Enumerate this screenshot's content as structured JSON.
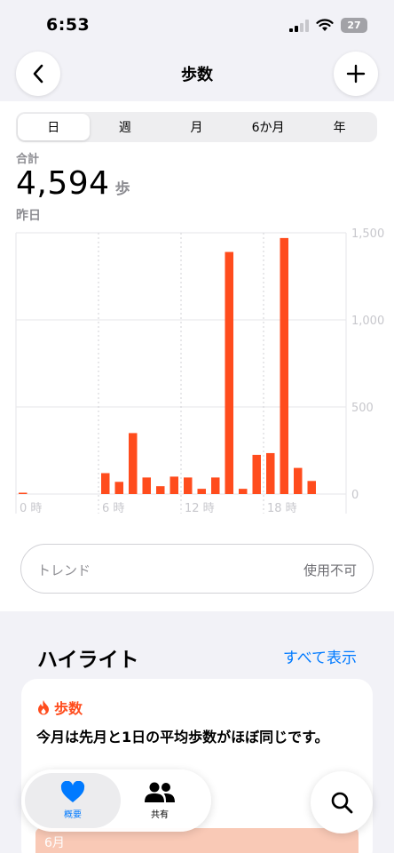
{
  "status": {
    "time": "6:53",
    "battery": "27"
  },
  "nav": {
    "title": "歩数"
  },
  "segments": [
    "日",
    "週",
    "月",
    "6か月",
    "年"
  ],
  "summary": {
    "label": "合計",
    "value": "4,594",
    "unit": "歩",
    "date": "昨日"
  },
  "chart_data": {
    "type": "bar",
    "x": [
      0,
      1,
      2,
      3,
      4,
      5,
      6,
      7,
      8,
      9,
      10,
      11,
      12,
      13,
      14,
      15,
      16,
      17,
      18,
      19,
      20,
      21,
      22,
      23
    ],
    "values": [
      5,
      0,
      0,
      0,
      0,
      0,
      120,
      70,
      350,
      95,
      45,
      100,
      95,
      30,
      95,
      1390,
      30,
      225,
      235,
      1470,
      150,
      75,
      0,
      0
    ],
    "xticks": [
      "0 時",
      "6 時",
      "12 時",
      "18 時"
    ],
    "xtick_hours": [
      0,
      6,
      12,
      18
    ],
    "yticks": [
      "0",
      "500",
      "1,000",
      "1,500"
    ],
    "ytick_values": [
      0,
      500,
      1000,
      1500
    ],
    "ylim": [
      0,
      1500
    ],
    "color": "#ff4c1d"
  },
  "trend": {
    "label": "トレンド",
    "status": "使用不可"
  },
  "highlights": {
    "title": "ハイライト",
    "see_all": "すべて表示",
    "card_label": "歩数",
    "card_text": "今月は先月と1日の平均歩数がほぼ同じです。",
    "month": "6月"
  },
  "tabs": {
    "summary": "概要",
    "sharing": "共有"
  },
  "colors": {
    "accent": "#007aff",
    "steps": "#ff4c1d"
  }
}
